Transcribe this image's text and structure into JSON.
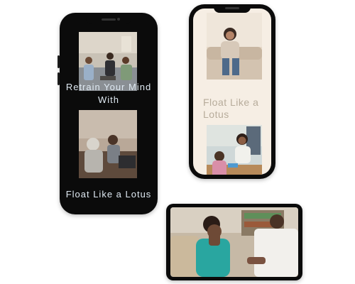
{
  "phone_left": {
    "caption_top": "Retrain Your Mind With",
    "caption_bottom": "Float Like a Lotus"
  },
  "phone_right": {
    "caption": "Float Like a Lotus"
  }
}
